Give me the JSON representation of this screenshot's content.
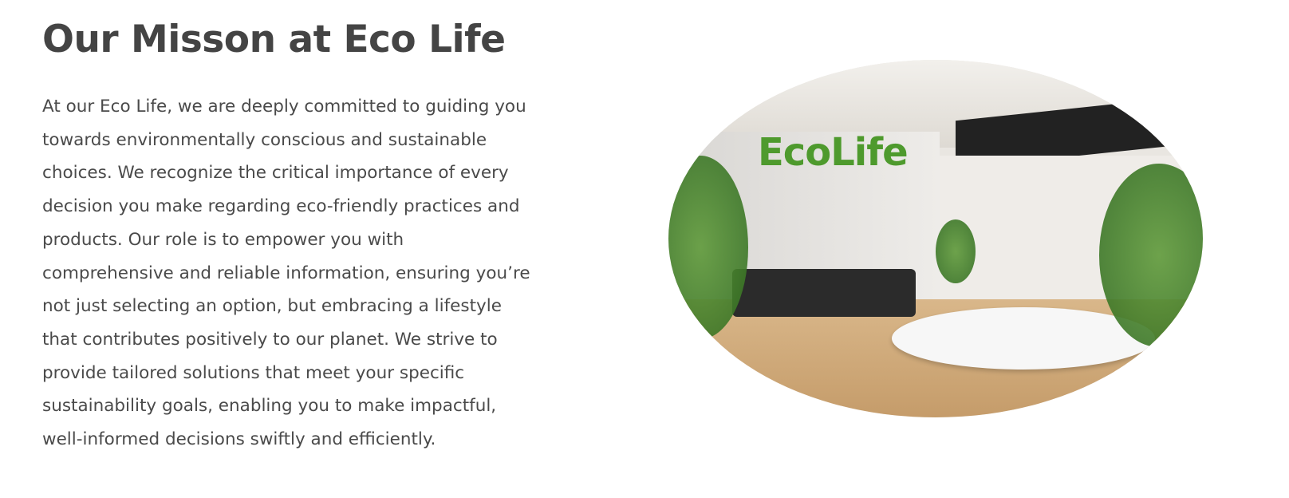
{
  "heading": "Our Misson at Eco Life",
  "paragraph_lines": [
    "At our Eco Life, we are deeply committed to guiding you",
    "towards environmentally conscious and sustainable",
    "choices. We recognize the critical importance of every",
    "decision you make regarding eco-friendly practices and",
    "products. Our role is to empower you with",
    "comprehensive and reliable information, ensuring you’re",
    "not just selecting an option, but embracing a lifestyle",
    "that contributes positively to our planet. We strive to",
    "provide tailored solutions that meet your specific",
    "sustainability goals, enabling you to make impactful,",
    "well-informed decisions swiftly and efficiently."
  ],
  "image": {
    "logo_text": "EcoLife",
    "logo_color": "#4e9a2d"
  }
}
